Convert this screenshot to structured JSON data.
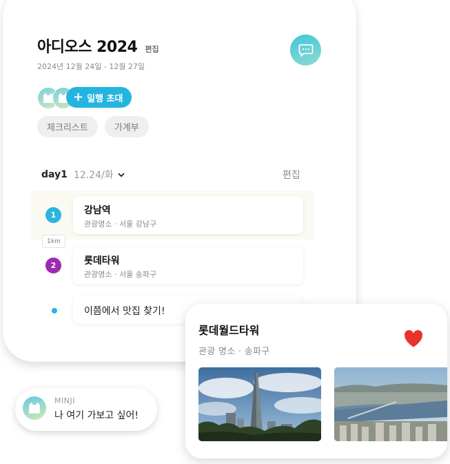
{
  "trip": {
    "title": "아디오스 2024",
    "edit_label": "편집",
    "dates": "2024년 12월 24일 - 12월 27일"
  },
  "header_actions": {
    "chat_icon": "chat-bubble-icon"
  },
  "members": {
    "invite_label": "일행 초대",
    "avatar_icon": "cat-face-icon"
  },
  "tabs": [
    {
      "label": "체크리스트"
    },
    {
      "label": "가계부"
    }
  ],
  "day": {
    "label": "day1",
    "date": "12.24/화",
    "edit_label": "편집"
  },
  "itinerary": [
    {
      "number": "1",
      "name": "강남역",
      "meta": "관광명소 · 서울 강남구",
      "color": "#2cb4e0"
    },
    {
      "distance": "1km"
    },
    {
      "number": "2",
      "name": "롯데타워",
      "meta": "관광명소 · 서울 송파구",
      "color": "#9b2bb0"
    },
    {
      "memo": "이쯤에서 맛집 찾기!"
    }
  ],
  "place_popup": {
    "name": "롯데월드타워",
    "meta": "관광 명소  ·  송파구",
    "liked": true,
    "heart_color": "#e8322c"
  },
  "comment": {
    "user": "MINJI",
    "text": "나 여기 가보고 싶어!"
  },
  "colors": {
    "accent": "#23b5df",
    "teal": "#3fc5dd"
  }
}
